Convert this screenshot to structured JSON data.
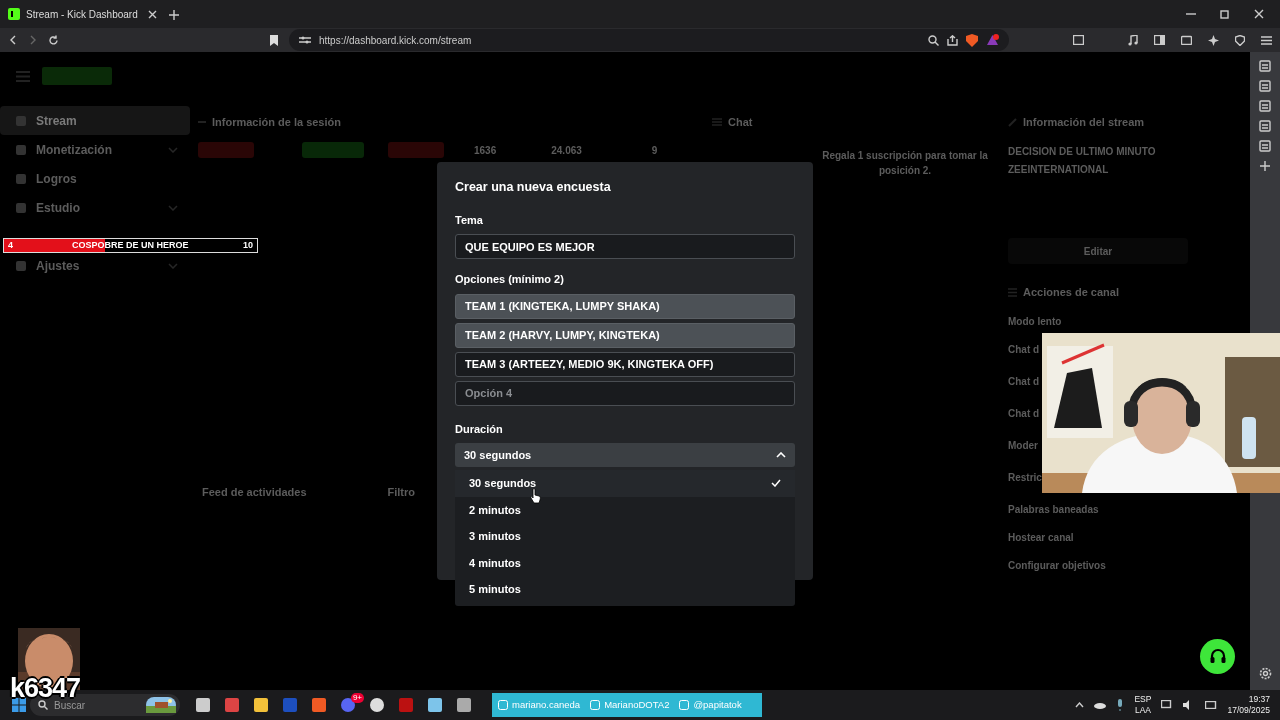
{
  "browser": {
    "tab_title": "Stream - Kick Dashboard",
    "url": "https://dashboard.kick.com/stream"
  },
  "dashboard": {
    "sidebar": [
      {
        "label": "Stream",
        "selected": true,
        "expandable": false
      },
      {
        "label": "Monetización",
        "selected": false,
        "expandable": true
      },
      {
        "label": "Logros",
        "selected": false,
        "expandable": false
      },
      {
        "label": "Estudio",
        "selected": false,
        "expandable": true
      },
      {
        "label": "Ajustes",
        "selected": false,
        "expandable": true
      }
    ],
    "session": {
      "title": "Información de la sesión",
      "stats": [
        "1636",
        "24.063",
        "9"
      ]
    },
    "chat": {
      "title": "Chat",
      "pinned": "Regala 1 suscripción para tomar la posición 2."
    },
    "stream_info": {
      "title": "Información del stream",
      "stream_title": "DECISION DE ULTIMO MINUTO ZEEINTERNATIONAL",
      "edit_button": "Editar"
    },
    "channel_actions": {
      "title": "Acciones de canal",
      "items": [
        "Modo lento",
        "Chat d",
        "Chat d",
        "Chat d",
        "Moder",
        "Restric",
        "Palabras baneadas",
        "Hostear canal",
        "Configurar objetivos"
      ]
    },
    "activity_feed": {
      "title": "Feed de actividades",
      "filter": "Filtro"
    }
  },
  "goal_bar": {
    "current": "4",
    "label": "COSPOBRE DE UN HEROE",
    "target": "10",
    "level": 0.4
  },
  "poll_modal": {
    "title": "Crear una nueva encuesta",
    "topic_label": "Tema",
    "topic_value": "QUE EQUIPO ES MEJOR",
    "options_label": "Opciones (mínimo 2)",
    "options": [
      {
        "value": "TEAM 1 (KINGTEKA, LUMPY SHAKA)",
        "highlighted": true
      },
      {
        "value": "TEAM 2 (HARVY, LUMPY, KINGTEKA)",
        "highlighted": true
      },
      {
        "value": "TEAM 3 (ARTEEZY, MEDIO 9K, KINGTEKA OFF)",
        "highlighted": false
      },
      {
        "placeholder": "Opción 4",
        "highlighted": false
      }
    ],
    "duration_label": "Duración",
    "duration_value": "30 segundos",
    "expanded": true,
    "duration_options": [
      {
        "label": "30 segundos",
        "selected": true
      },
      {
        "label": "2 minutos",
        "selected": false
      },
      {
        "label": "3 minutos",
        "selected": false
      },
      {
        "label": "4 minutos",
        "selected": false
      },
      {
        "label": "5 minutos",
        "selected": false
      }
    ]
  },
  "streamer_tag": "k6347",
  "taskbar": {
    "search_placeholder": "Buscar",
    "discord_badge": "9+",
    "socials": [
      "mariano.caneda",
      "MarianoDOTA2",
      "@papitatok"
    ],
    "language": "ESP",
    "layout": "LAA",
    "time": "19:37",
    "date": "17/09/2025"
  }
}
